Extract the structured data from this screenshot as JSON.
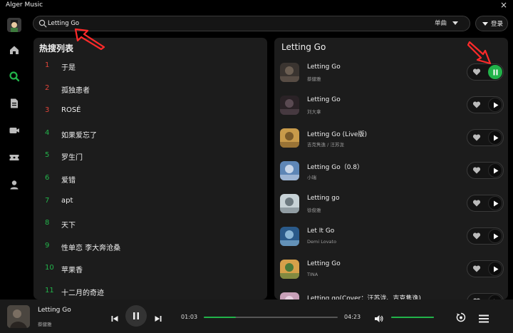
{
  "app": {
    "title": "Alger Music",
    "close_glyph": "×"
  },
  "colors": {
    "accent": "#22b34a",
    "rank_hot": "#e0453a",
    "rank_normal": "#22b34a",
    "panel": "#1c1c1c",
    "background": "#000000"
  },
  "sidebar": {
    "items": [
      {
        "icon": "home-icon",
        "active": false
      },
      {
        "icon": "search-icon",
        "active": true
      },
      {
        "icon": "document-icon",
        "active": false
      },
      {
        "icon": "video-icon",
        "active": false
      },
      {
        "icon": "ticket-icon",
        "active": false
      },
      {
        "icon": "user-icon",
        "active": false
      }
    ]
  },
  "search": {
    "value": "Letting Go",
    "placeholder": "",
    "type_label": "单曲"
  },
  "header": {
    "login_label": "登录"
  },
  "hot_list": {
    "title": "热搜列表",
    "items": [
      {
        "rank": "1",
        "name": "于是"
      },
      {
        "rank": "2",
        "name": "孤独患者"
      },
      {
        "rank": "3",
        "name": "ROSÉ"
      },
      {
        "rank": "4",
        "name": "如果爱忘了"
      },
      {
        "rank": "5",
        "name": "罗生门"
      },
      {
        "rank": "6",
        "name": "爱错"
      },
      {
        "rank": "7",
        "name": "apt"
      },
      {
        "rank": "8",
        "name": "天下"
      },
      {
        "rank": "9",
        "name": "性单恋 李大奔沧桑"
      },
      {
        "rank": "10",
        "name": "苹果香"
      },
      {
        "rank": "11",
        "name": "十二月的奇迹"
      }
    ]
  },
  "results": {
    "title": "Letting Go",
    "songs": [
      {
        "name": "Letting Go",
        "artist": "蔡健雅",
        "playing": true
      },
      {
        "name": "Letting Go",
        "artist": "刘大拿",
        "playing": false
      },
      {
        "name": "Letting Go (Live版)",
        "artist": "吉克隽逸 / 汪苏泷",
        "playing": false
      },
      {
        "name": "Letting Go（0.8）",
        "artist": "小瑞",
        "playing": false
      },
      {
        "name": "Letting go",
        "artist": "徐俊雅",
        "playing": false
      },
      {
        "name": "Let It Go",
        "artist": "Demi Lovato",
        "playing": false
      },
      {
        "name": "Letting Go",
        "artist": "TINA",
        "playing": false
      },
      {
        "name": "Letting go(Cover：汪苏泷、吉克隽逸)",
        "artist": "",
        "playing": false
      }
    ]
  },
  "player": {
    "song": "Letting Go",
    "artist": "蔡健雅",
    "current_time": "01:03",
    "total_time": "04:23",
    "progress_fraction": 0.24,
    "volume_fraction": 1.0
  }
}
